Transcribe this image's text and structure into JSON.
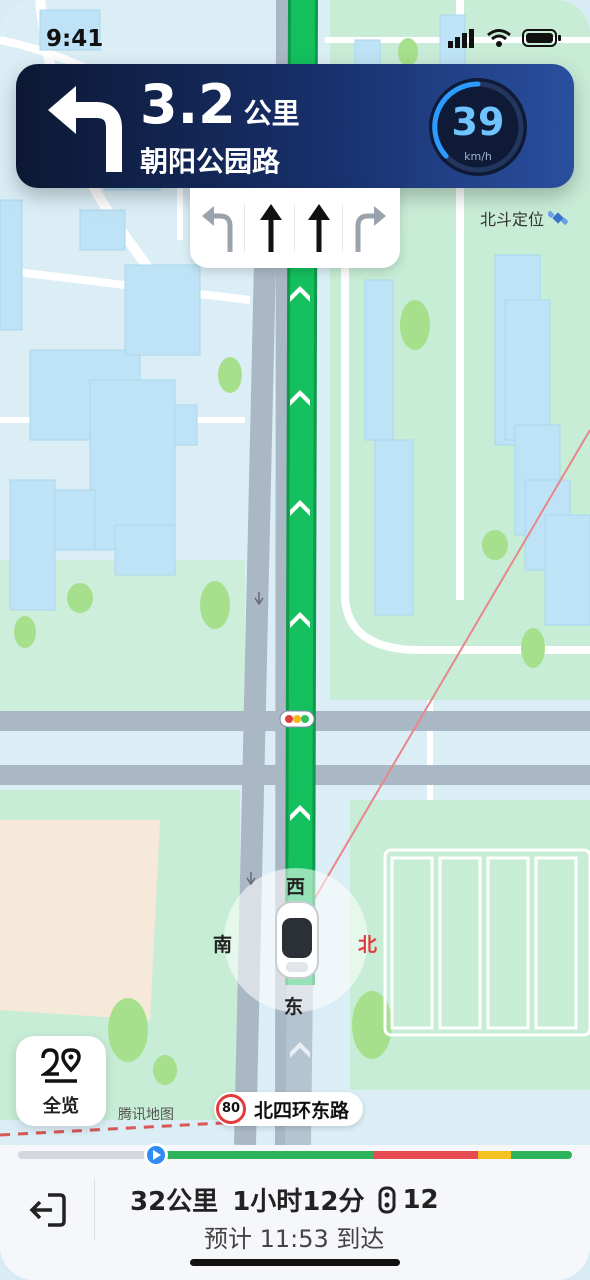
{
  "status_bar": {
    "time": "9:41"
  },
  "guidance": {
    "turn_icon": "turn-left-arrow-icon",
    "distance_value": "3.2",
    "distance_unit": "公里",
    "next_road": "朝阳公园路",
    "speed": "39",
    "speed_unit": "km/h"
  },
  "lanes": [
    {
      "icon": "lane-left-turn-icon",
      "recommended": false
    },
    {
      "icon": "lane-straight-icon",
      "recommended": true
    },
    {
      "icon": "lane-straight-icon",
      "recommended": true
    },
    {
      "icon": "lane-right-turn-icon",
      "recommended": false
    }
  ],
  "beidou_label": "北斗定位",
  "compass": {
    "north": "北",
    "south": "南",
    "east": "东",
    "west": "西"
  },
  "overview_button": {
    "label": "全览",
    "icon": "overview-route-icon"
  },
  "map_watermark": "腾讯地图",
  "current_road": {
    "speed_limit": "80",
    "name": "北四环东路"
  },
  "trip": {
    "distance": "32公里",
    "duration": "1小时12分",
    "traffic_lights": "12",
    "eta": "预计 11:53 到达"
  },
  "progress": {
    "fraction_traveled": 0.25,
    "traffic_segments": [
      {
        "status": "smooth",
        "from": 0.25,
        "to": 0.64,
        "color": "#2cb35c"
      },
      {
        "status": "congested",
        "from": 0.64,
        "to": 0.83,
        "color": "#e84a52"
      },
      {
        "status": "slow",
        "from": 0.83,
        "to": 0.89,
        "color": "#f5c122"
      },
      {
        "status": "smooth",
        "from": 0.89,
        "to": 1.0,
        "color": "#2cb35c"
      }
    ]
  },
  "colors": {
    "route": "#10b45a",
    "banner": "#132a5c",
    "speed_ring": "#2b9cff"
  }
}
